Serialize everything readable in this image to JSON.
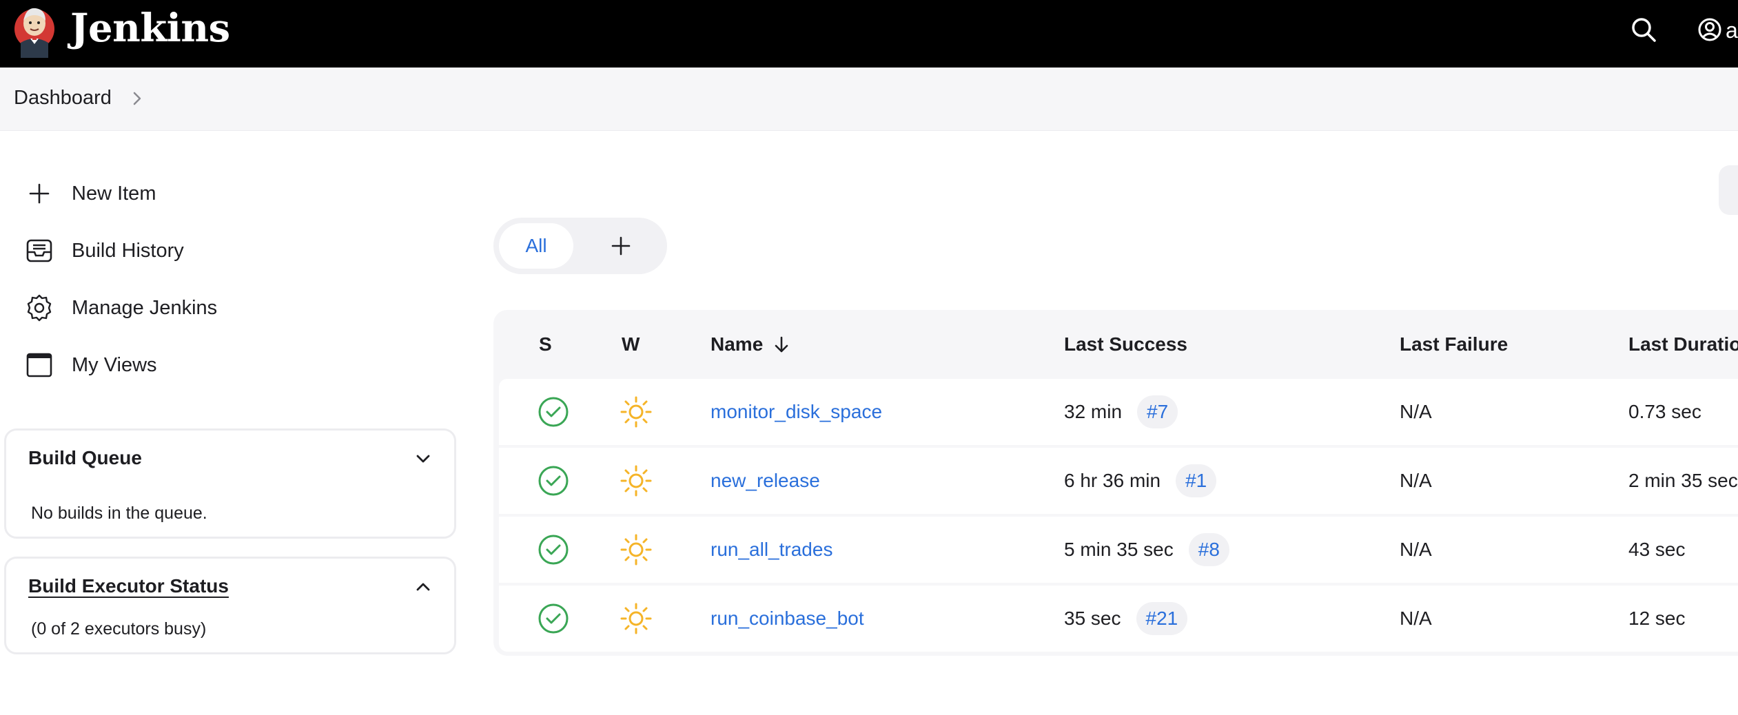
{
  "header": {
    "brand": "Jenkins",
    "user_initial": "a",
    "logo_icon": "jenkins-butler-logo",
    "search_icon": "search-icon",
    "user_icon": "user-circle-icon"
  },
  "breadcrumb": {
    "items": [
      {
        "label": "Dashboard"
      }
    ]
  },
  "sidebar": {
    "tasks": [
      {
        "label": "New Item",
        "icon": "plus-icon"
      },
      {
        "label": "Build History",
        "icon": "inbox-tray-icon"
      },
      {
        "label": "Manage Jenkins",
        "icon": "gear-icon"
      },
      {
        "label": "My Views",
        "icon": "window-icon"
      }
    ],
    "build_queue": {
      "title": "Build Queue",
      "body": "No builds in the queue.",
      "toggle_icon": "chevron-down-icon"
    },
    "executor_status": {
      "title": "Build Executor Status",
      "body": "(0 of 2 executors busy)",
      "toggle_icon": "chevron-up-icon"
    }
  },
  "views": {
    "tabs": [
      {
        "label": "All",
        "active": true
      }
    ],
    "add_icon": "plus-icon"
  },
  "jobs_table": {
    "columns": {
      "status": "S",
      "weather": "W",
      "name": "Name",
      "name_sort_icon": "arrow-down-icon",
      "last_success": "Last Success",
      "last_failure": "Last Failure",
      "last_duration": "Last Duration"
    },
    "rows": [
      {
        "name": "monitor_disk_space",
        "last_success": "32 min",
        "build": "#7",
        "last_failure": "N/A",
        "duration": "0.73 sec",
        "status_icon": "success-check-icon",
        "weather_icon": "sunny-weather-icon"
      },
      {
        "name": "new_release",
        "last_success": "6 hr 36 min",
        "build": "#1",
        "last_failure": "N/A",
        "duration": "2 min 35 sec",
        "status_icon": "success-check-icon",
        "weather_icon": "sunny-weather-icon"
      },
      {
        "name": "run_all_trades",
        "last_success": "5 min 35 sec",
        "build": "#8",
        "last_failure": "N/A",
        "duration": "43 sec",
        "status_icon": "success-check-icon",
        "weather_icon": "sunny-weather-icon"
      },
      {
        "name": "run_coinbase_bot",
        "last_success": "35 sec",
        "build": "#21",
        "last_failure": "N/A",
        "duration": "12 sec",
        "status_icon": "success-check-icon",
        "weather_icon": "sunny-weather-icon"
      }
    ]
  },
  "colors": {
    "header_bg": "#000000",
    "link": "#2a6fdb",
    "success": "#3aa655",
    "weather": "#f5b428"
  }
}
